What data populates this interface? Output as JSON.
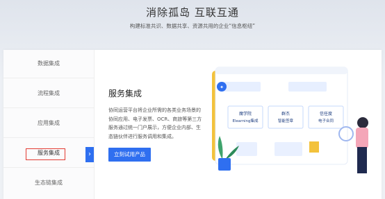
{
  "hero": {
    "title": "消除孤岛 互联互通",
    "subtitle": "构建标准共识、数据共享、资源共用的企业“信息枢纽”"
  },
  "sidebar": {
    "items": [
      {
        "label": "数据集成",
        "active": false
      },
      {
        "label": "流程集成",
        "active": false
      },
      {
        "label": "应用集成",
        "active": false
      },
      {
        "label": "服务集成",
        "active": true
      },
      {
        "label": "生态链集成",
        "active": false
      }
    ],
    "arrow_icon": "chevron-right-icon"
  },
  "service": {
    "title": "服务集成",
    "description": "协同运营平台将企业所需的各类业务场景的协同应用、电子发票、OCR、商旅等第三方服务通过统一门户展示，方便企业内部、生态链伙伴进行服务调用和集成。",
    "cta_label": "立刻试用产品"
  },
  "illustration": {
    "cards": [
      {
        "line1": "魔学院",
        "line2": "Elearning集成"
      },
      {
        "line1": "群杰",
        "line2": "智能签章"
      },
      {
        "line1": "信任度",
        "line2": "电子合同"
      }
    ]
  },
  "colors": {
    "accent": "#2f6ff0",
    "highlight_border": "#e23a32"
  }
}
